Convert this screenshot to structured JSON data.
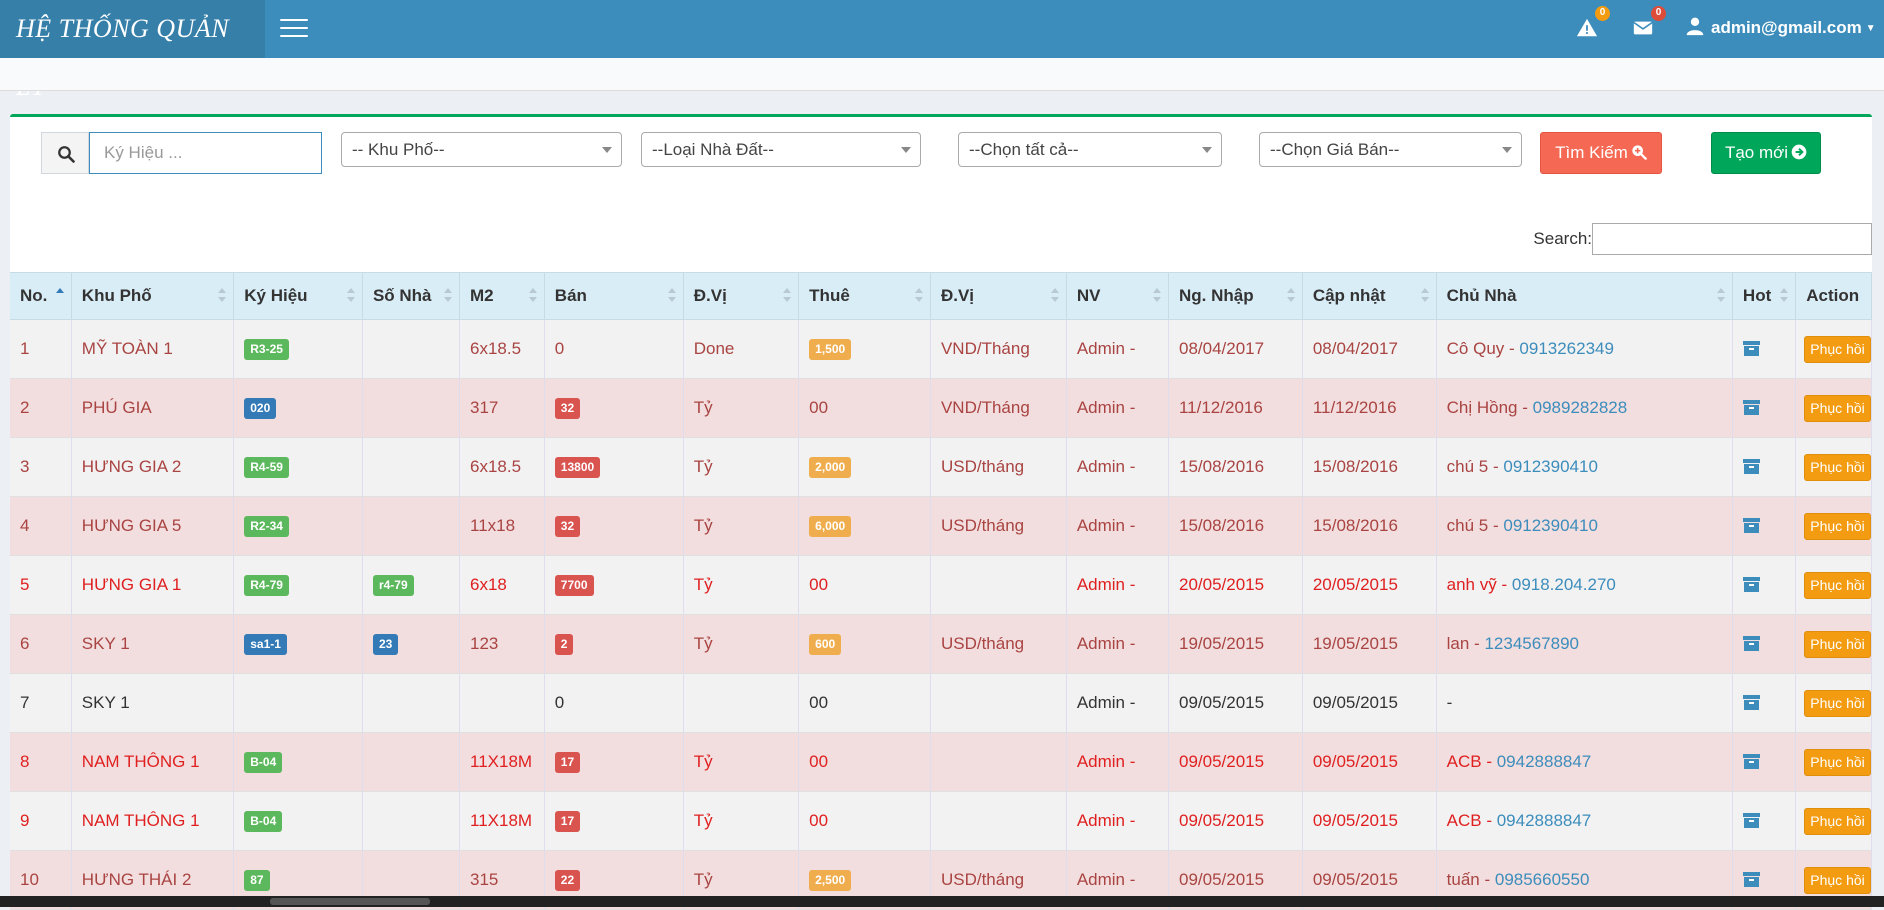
{
  "header": {
    "logo": "HỆ THỐNG QUẢN LÝ",
    "alerts_count": "0",
    "messages_count": "0",
    "user_email": "admin@gmail.com",
    "alerts_badge_color": "#f39c12",
    "messages_badge_color": "#dd4b39"
  },
  "filters": {
    "search_placeholder": "Ký Hiệu ...",
    "khu_pho": "-- Khu Phố--",
    "loai_nha_dat": "--Loại Nhà Đất--",
    "chon_tat_ca": "--Chọn tất cả--",
    "chon_gia_ban": "--Chọn Giá Bán--",
    "search_button": "Tìm Kiếm",
    "create_button": "Tạo mới"
  },
  "table_search_label": "Search:",
  "columns": [
    "No.",
    "Khu Phố",
    "Ký Hiệu",
    "Số Nhà",
    "M2",
    "Bán",
    "Đ.Vị",
    "Thuê",
    "Đ.Vị",
    "NV",
    "Ng. Nhập",
    "Cập nhật",
    "Chủ Nhà",
    "Hot",
    "Action"
  ],
  "rows": [
    {
      "no": "1",
      "khu_pho": "MỸ TOÀN 1",
      "ky_hieu": "R3-25",
      "ky_hieu_color": "success",
      "so_nha": "",
      "so_nha_color": "",
      "m2": "6x18.5",
      "ban": "0",
      "ban_label": false,
      "dv1": "Done",
      "thue": "1,500",
      "thue_label": true,
      "dv2": "VND/Tháng",
      "nv": "Admin -",
      "ng_nhap": "08/04/2017",
      "cap_nhat": "08/04/2017",
      "chu_nha": "Cô Quy -",
      "phone": "0913262349",
      "action": "Phục hồi"
    },
    {
      "no": "2",
      "khu_pho": "PHÚ GIA",
      "ky_hieu": "020",
      "ky_hieu_color": "primary",
      "so_nha": "",
      "so_nha_color": "",
      "m2": "317",
      "ban": "32",
      "ban_label": true,
      "dv1": "Tỷ",
      "thue": "00",
      "thue_label": false,
      "dv2": "VND/Tháng",
      "nv": "Admin -",
      "ng_nhap": "11/12/2016",
      "cap_nhat": "11/12/2016",
      "chu_nha": "Chị Hồng -",
      "phone": "0989282828",
      "action": "Phục hồi"
    },
    {
      "no": "3",
      "khu_pho": "HƯNG GIA 2",
      "ky_hieu": "R4-59",
      "ky_hieu_color": "success",
      "so_nha": "",
      "so_nha_color": "",
      "m2": "6x18.5",
      "ban": "13800",
      "ban_label": true,
      "dv1": "Tỷ",
      "thue": "2,000",
      "thue_label": true,
      "dv2": "USD/tháng",
      "nv": "Admin -",
      "ng_nhap": "15/08/2016",
      "cap_nhat": "15/08/2016",
      "chu_nha": "chú 5 -",
      "phone": "0912390410",
      "action": "Phục hồi"
    },
    {
      "no": "4",
      "khu_pho": "HƯNG GIA 5",
      "ky_hieu": "R2-34",
      "ky_hieu_color": "success",
      "so_nha": "",
      "so_nha_color": "",
      "m2": "11x18",
      "ban": "32",
      "ban_label": true,
      "dv1": "Tỷ",
      "thue": "6,000",
      "thue_label": true,
      "dv2": "USD/tháng",
      "nv": "Admin -",
      "ng_nhap": "15/08/2016",
      "cap_nhat": "15/08/2016",
      "chu_nha": "chú 5 -",
      "phone": "0912390410",
      "action": "Phục hồi"
    },
    {
      "no": "5",
      "khu_pho": "HƯNG GIA 1",
      "ky_hieu": "R4-79",
      "ky_hieu_color": "success",
      "so_nha": "r4-79",
      "so_nha_color": "success",
      "m2": "6x18",
      "ban": "7700",
      "ban_label": true,
      "dv1": "Tỷ",
      "thue": "00",
      "thue_label": false,
      "dv2": "",
      "nv": "Admin -",
      "ng_nhap": "20/05/2015",
      "cap_nhat": "20/05/2015",
      "chu_nha": "anh vỹ -",
      "phone": "0918.204.270",
      "action": "Phục hồi"
    },
    {
      "no": "6",
      "khu_pho": "SKY 1",
      "ky_hieu": "sa1-1",
      "ky_hieu_color": "primary",
      "so_nha": "23",
      "so_nha_color": "primary",
      "m2": "123",
      "ban": "2",
      "ban_label": true,
      "dv1": "Tỷ",
      "thue": "600",
      "thue_label": true,
      "dv2": "USD/tháng",
      "nv": "Admin -",
      "ng_nhap": "19/05/2015",
      "cap_nhat": "19/05/2015",
      "chu_nha": "lan -",
      "phone": "1234567890",
      "action": "Phục hồi"
    },
    {
      "no": "7",
      "khu_pho": "SKY 1",
      "ky_hieu": "",
      "ky_hieu_color": "",
      "so_nha": "",
      "so_nha_color": "",
      "m2": "",
      "ban": "0",
      "ban_label": false,
      "dv1": "",
      "thue": "00",
      "thue_label": false,
      "dv2": "",
      "nv": "Admin -",
      "ng_nhap": "09/05/2015",
      "cap_nhat": "09/05/2015",
      "chu_nha": "-",
      "phone": "",
      "action": "Phục hồi"
    },
    {
      "no": "8",
      "khu_pho": "NAM THÔNG 1",
      "ky_hieu": "B-04",
      "ky_hieu_color": "success",
      "so_nha": "",
      "so_nha_color": "",
      "m2": "11X18M",
      "ban": "17",
      "ban_label": true,
      "dv1": "Tỷ",
      "thue": "00",
      "thue_label": false,
      "dv2": "",
      "nv": "Admin -",
      "ng_nhap": "09/05/2015",
      "cap_nhat": "09/05/2015",
      "chu_nha": "ACB -",
      "phone": "0942888847",
      "action": "Phục hồi"
    },
    {
      "no": "9",
      "khu_pho": "NAM THÔNG 1",
      "ky_hieu": "B-04",
      "ky_hieu_color": "success",
      "so_nha": "",
      "so_nha_color": "",
      "m2": "11X18M",
      "ban": "17",
      "ban_label": true,
      "dv1": "Tỷ",
      "thue": "00",
      "thue_label": false,
      "dv2": "",
      "nv": "Admin -",
      "ng_nhap": "09/05/2015",
      "cap_nhat": "09/05/2015",
      "chu_nha": "ACB -",
      "phone": "0942888847",
      "action": "Phục hồi"
    },
    {
      "no": "10",
      "khu_pho": "HƯNG THÁI 2",
      "ky_hieu": "87",
      "ky_hieu_color": "success",
      "so_nha": "",
      "so_nha_color": "",
      "m2": "315",
      "ban": "22",
      "ban_label": true,
      "dv1": "Tỷ",
      "thue": "2,500",
      "thue_label": true,
      "dv2": "USD/tháng",
      "nv": "Admin -",
      "ng_nhap": "09/05/2015",
      "cap_nhat": "09/05/2015",
      "chu_nha": "tuấn -",
      "phone": "0985660550",
      "action": "Phục hồi"
    }
  ],
  "row_styles": [
    "odd",
    "pink",
    "odd",
    "pink",
    "odd red",
    "pink",
    "odd plain",
    "pink red",
    "odd red",
    "pink"
  ],
  "icons": {
    "alerts": "warning-icon",
    "messages": "envelope-icon",
    "user": "user-icon",
    "search": "search-icon",
    "hot": "archive-icon"
  }
}
